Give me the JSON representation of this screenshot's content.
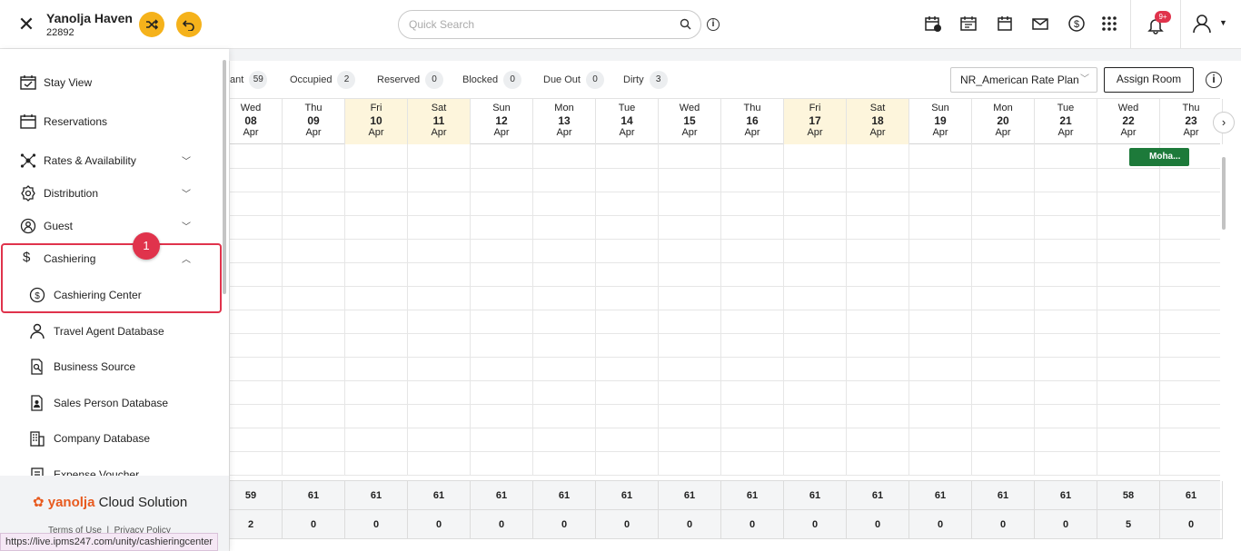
{
  "header": {
    "hotel_name": "Yanolja Haven",
    "hotel_id": "22892",
    "search_placeholder": "Quick Search",
    "notification_badge": "9+"
  },
  "stats": [
    {
      "label": "ant",
      "count": "59"
    },
    {
      "label": "Occupied",
      "count": "2"
    },
    {
      "label": "Reserved",
      "count": "0"
    },
    {
      "label": "Blocked",
      "count": "0"
    },
    {
      "label": "Due Out",
      "count": "0"
    },
    {
      "label": "Dirty",
      "count": "3"
    }
  ],
  "toolbar": {
    "rate_plan": "NR_American Rate Plan",
    "assign_room": "Assign Room"
  },
  "dates": [
    {
      "day": "Wed",
      "date": "08",
      "month": "Apr",
      "weekend": false
    },
    {
      "day": "Thu",
      "date": "09",
      "month": "Apr",
      "weekend": false
    },
    {
      "day": "Fri",
      "date": "10",
      "month": "Apr",
      "weekend": true
    },
    {
      "day": "Sat",
      "date": "11",
      "month": "Apr",
      "weekend": true
    },
    {
      "day": "Sun",
      "date": "12",
      "month": "Apr",
      "weekend": false
    },
    {
      "day": "Mon",
      "date": "13",
      "month": "Apr",
      "weekend": false
    },
    {
      "day": "Tue",
      "date": "14",
      "month": "Apr",
      "weekend": false
    },
    {
      "day": "Wed",
      "date": "15",
      "month": "Apr",
      "weekend": false
    },
    {
      "day": "Thu",
      "date": "16",
      "month": "Apr",
      "weekend": false
    },
    {
      "day": "Fri",
      "date": "17",
      "month": "Apr",
      "weekend": true
    },
    {
      "day": "Sat",
      "date": "18",
      "month": "Apr",
      "weekend": true
    },
    {
      "day": "Sun",
      "date": "19",
      "month": "Apr",
      "weekend": false
    },
    {
      "day": "Mon",
      "date": "20",
      "month": "Apr",
      "weekend": false
    },
    {
      "day": "Tue",
      "date": "21",
      "month": "Apr",
      "weekend": false
    },
    {
      "day": "Wed",
      "date": "22",
      "month": "Apr",
      "weekend": false
    },
    {
      "day": "Thu",
      "date": "23",
      "month": "Apr",
      "weekend": false
    }
  ],
  "booking": {
    "guest": "Moha..."
  },
  "totals": {
    "available": [
      "59",
      "61",
      "61",
      "61",
      "61",
      "61",
      "61",
      "61",
      "61",
      "61",
      "61",
      "61",
      "61",
      "61",
      "58",
      "61"
    ],
    "occupied": [
      "2",
      "0",
      "0",
      "0",
      "0",
      "0",
      "0",
      "0",
      "0",
      "0",
      "0",
      "0",
      "0",
      "0",
      "5",
      "0"
    ]
  },
  "sidebar": {
    "items": [
      {
        "label": "Stay View",
        "icon": "calendar-check-icon"
      },
      {
        "label": "Reservations",
        "icon": "calendar-icon"
      },
      {
        "label": "Rates & Availability",
        "icon": "network-icon"
      },
      {
        "label": "Distribution",
        "icon": "gear-icon"
      },
      {
        "label": "Guest",
        "icon": "guest-icon"
      },
      {
        "label": "Cashiering",
        "icon": "dollar-icon"
      }
    ],
    "subitems": [
      {
        "label": "Cashiering Center",
        "icon": "dollar-circle-icon"
      },
      {
        "label": "Travel Agent Database",
        "icon": "person-icon"
      },
      {
        "label": "Business Source",
        "icon": "document-search-icon"
      },
      {
        "label": "Sales Person Database",
        "icon": "person-card-icon"
      },
      {
        "label": "Company Database",
        "icon": "building-icon"
      },
      {
        "label": "Expense Voucher",
        "icon": "voucher-icon"
      }
    ],
    "step_number": "1",
    "brand_y": "yanolja",
    "brand_rest": " Cloud Solution",
    "terms": "Terms of Use",
    "privacy": "Privacy Policy"
  },
  "status_url": "https://live.ipms247.com/unity/cashieringcenter"
}
